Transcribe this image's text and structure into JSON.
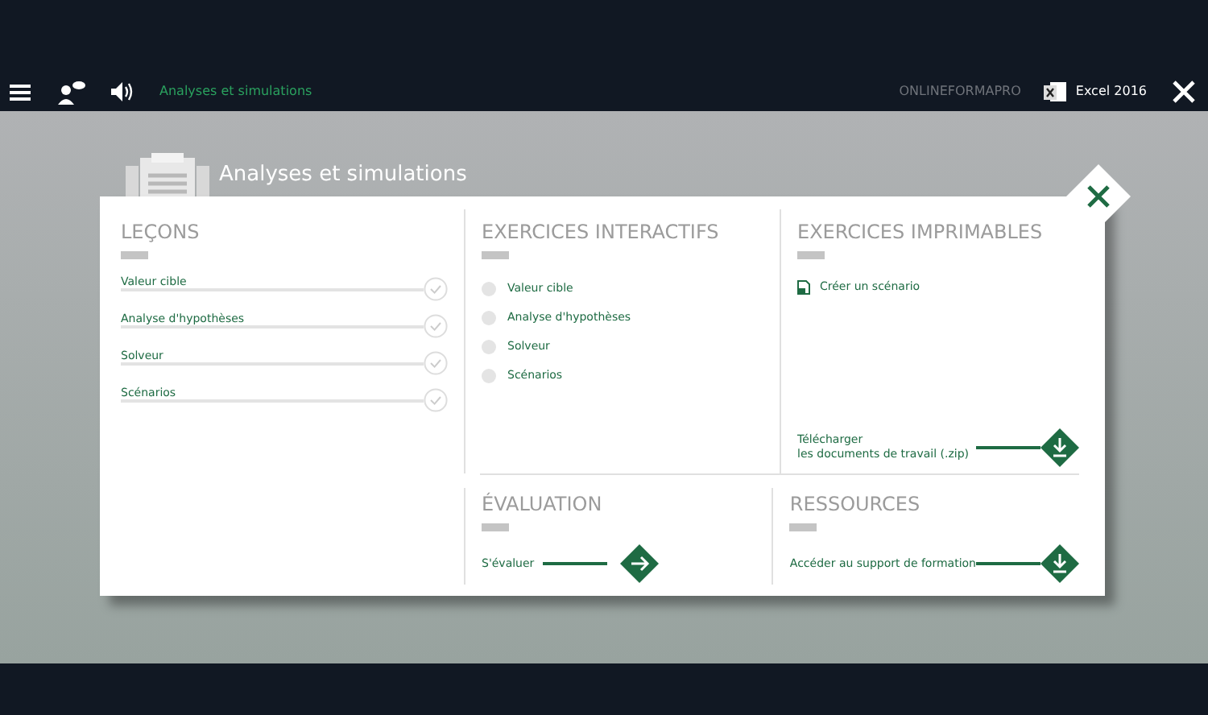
{
  "top_bar": {
    "breadcrumb": "Analyses et simulations",
    "brand": "ONLINEFORMAPRO",
    "product": "Excel 2016"
  },
  "panel": {
    "title": "Analyses et simulations"
  },
  "lessons": {
    "heading": "LEÇONS",
    "items": [
      {
        "label": "Valeur cible"
      },
      {
        "label": "Analyse d'hypothèses"
      },
      {
        "label": "Solveur"
      },
      {
        "label": "Scénarios"
      }
    ]
  },
  "interactive_exercises": {
    "heading": "EXERCICES INTERACTIFS",
    "items": [
      {
        "label": "Valeur cible"
      },
      {
        "label": "Analyse d'hypothèses"
      },
      {
        "label": "Solveur"
      },
      {
        "label": "Scénarios"
      }
    ]
  },
  "printable_exercises": {
    "heading": "EXERCICES IMPRIMABLES",
    "items": [
      {
        "label": "Créer un scénario"
      }
    ],
    "download": {
      "line_1": "Télécharger",
      "line_2": "les documents de travail (.zip)"
    }
  },
  "evaluation": {
    "heading": "ÉVALUATION",
    "action": "S'évaluer"
  },
  "resources": {
    "heading": "RESSOURCES",
    "action": "Accéder au support de formation"
  }
}
